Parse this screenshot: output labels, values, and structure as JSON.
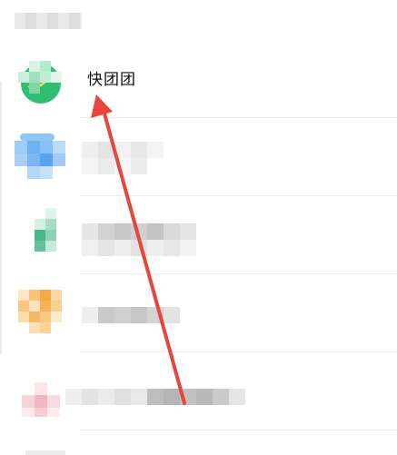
{
  "app_list": {
    "highlighted_item": {
      "label": "快团团",
      "icon": "kuaituantuan-logo-icon",
      "accent": "#3cc27a"
    },
    "blurred_items": [
      {
        "icon": "blurred-app-icon",
        "accent": "#6fb2f2"
      },
      {
        "icon": "blurred-app-icon",
        "accent": "#48b58b"
      },
      {
        "icon": "blurred-app-icon",
        "accent": "#f5a941"
      },
      {
        "icon": "blurred-app-icon",
        "accent": "#f0b7c0"
      }
    ]
  },
  "annotation": {
    "shape": "arrow",
    "color": "#e8463c",
    "points_to": "快团团"
  }
}
